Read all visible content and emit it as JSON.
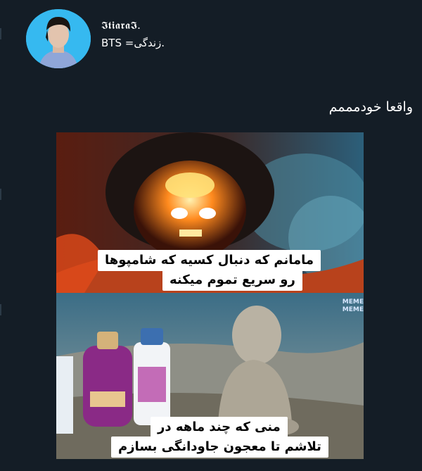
{
  "profile": {
    "display_name": "𝕴𝖙𝖎𝖆𝖗𝖆𝕴.",
    "bio": "BTS =زندگی."
  },
  "tweet": {
    "text": "واقعا خودمممم"
  },
  "meme": {
    "top_caption_line1": "مامانم که دنبال کسیه که شامپوها",
    "top_caption_line2": "رو سریع تموم میکنه",
    "bottom_caption_line1": "منی که چند ماهه در",
    "bottom_caption_line2": "تلاشم تا معجون جاودانگی بسازم",
    "watermark_line1": "MEME",
    "watermark_line2": "MEME"
  },
  "colors": {
    "background": "#141d26",
    "text": "#ffffff",
    "avatar_bg": "#36b9f0"
  }
}
